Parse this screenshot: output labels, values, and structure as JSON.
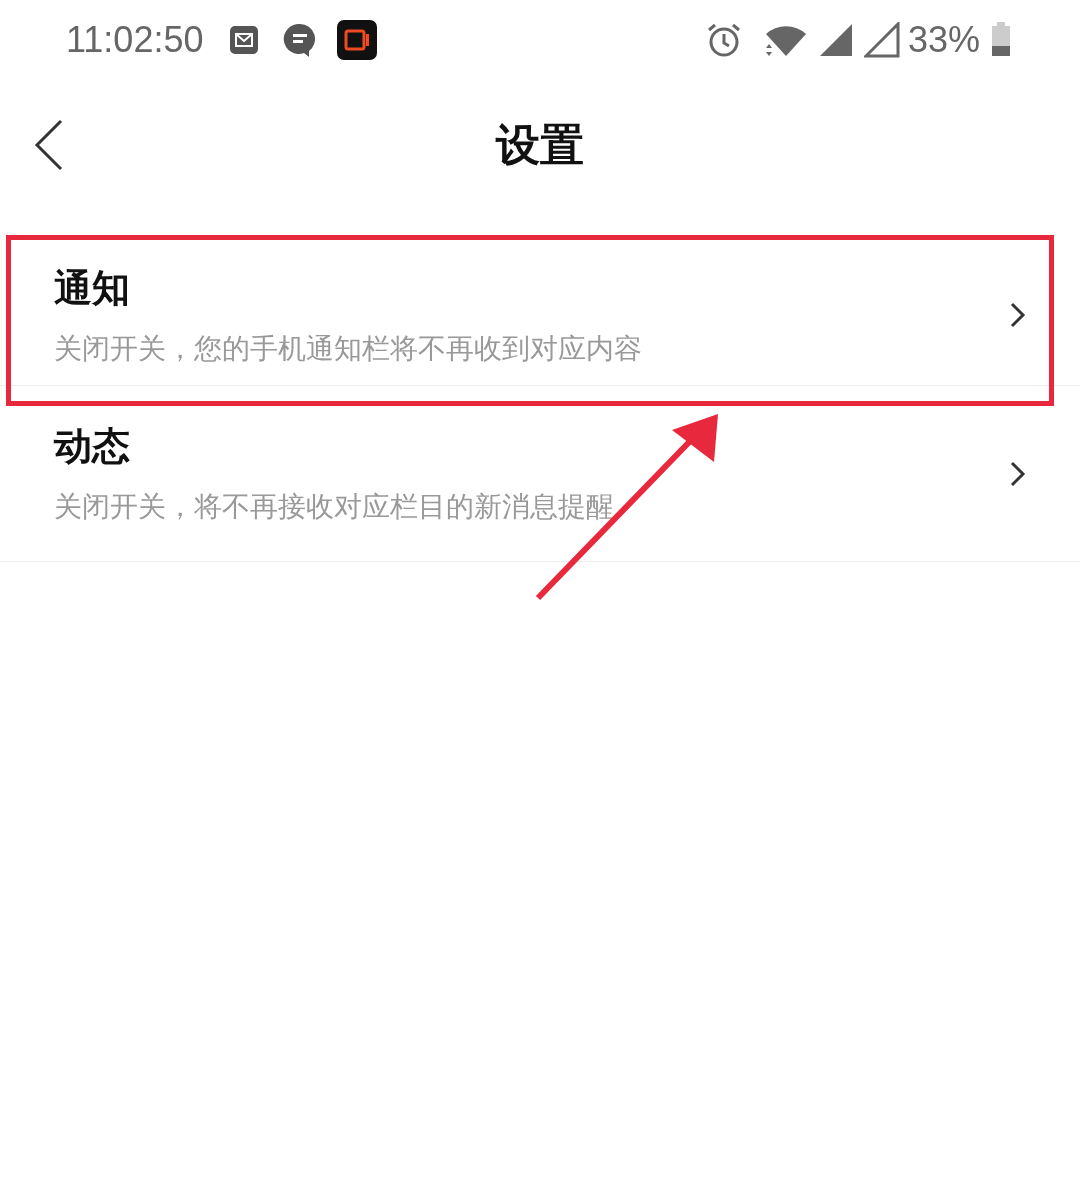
{
  "status_bar": {
    "time": "11:02:50",
    "battery": "33%"
  },
  "header": {
    "title": "设置"
  },
  "items": [
    {
      "title": "通知",
      "description": "关闭开关，您的手机通知栏将不再收到对应内容",
      "highlighted": true
    },
    {
      "title": "动态",
      "description": "关闭开关，将不再接收对应栏目的新消息提醒",
      "highlighted": false
    }
  ]
}
